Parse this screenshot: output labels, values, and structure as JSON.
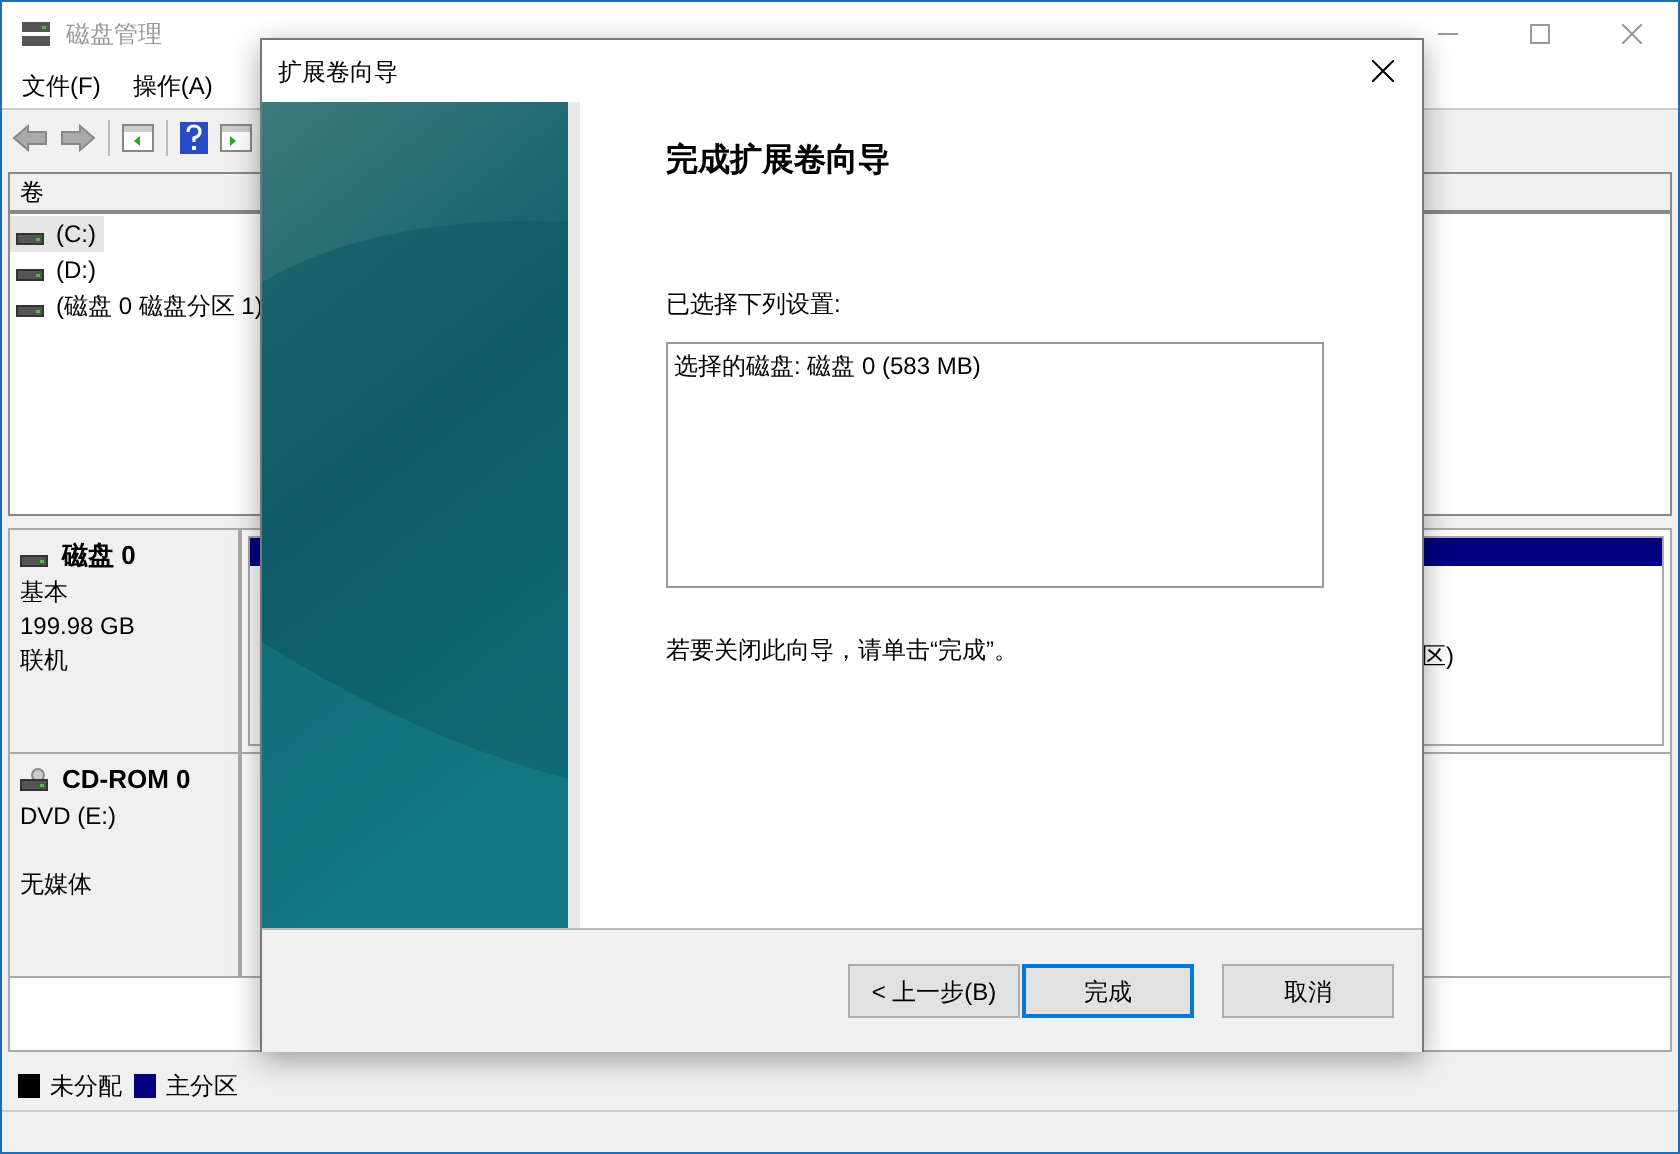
{
  "window": {
    "title": "磁盘管理"
  },
  "menu": [
    {
      "label": "文件(F)"
    },
    {
      "label": "操作(A)"
    }
  ],
  "volume_list": {
    "column": "卷",
    "rows": [
      {
        "name": "(C:)",
        "selected": true
      },
      {
        "name": "(D:)",
        "selected": false
      },
      {
        "name": "(磁盘 0 磁盘分区 1)",
        "selected": false
      }
    ]
  },
  "disks": [
    {
      "kind": "disk",
      "name": "磁盘 0",
      "lines": [
        "基本",
        "199.98 GB",
        "联机"
      ],
      "partition_label": "区)"
    },
    {
      "kind": "cdrom",
      "name": "CD-ROM 0",
      "lines": [
        "DVD (E:)",
        "无媒体"
      ]
    }
  ],
  "legend": [
    {
      "label": "未分配",
      "color": "#000000"
    },
    {
      "label": "主分区",
      "color": "#000080"
    }
  ],
  "dialog": {
    "title": "扩展卷向导",
    "heading": "完成扩展卷向导",
    "settings_label": "已选择下列设置:",
    "settings": "选择的磁盘: 磁盘 0 (583 MB)",
    "hint": "若要关闭此向导，请单击“完成”。",
    "buttons": [
      {
        "label": "< 上一步(B)",
        "default": false
      },
      {
        "label": "完成",
        "default": true
      },
      {
        "label": "取消",
        "default": false
      }
    ]
  }
}
